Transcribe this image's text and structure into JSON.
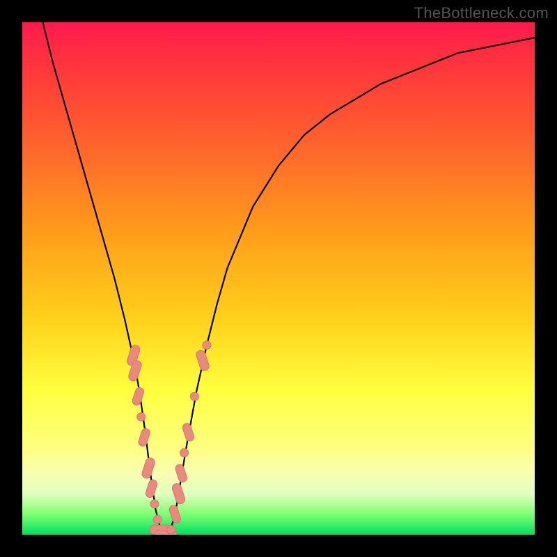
{
  "watermark": "TheBottleneck.com",
  "colors": {
    "frame": "#000000",
    "gradient_stops": [
      "#ff1a4d",
      "#ff3a3a",
      "#ff6a2a",
      "#ff9a1a",
      "#ffd21a",
      "#ffff40",
      "#ffff80",
      "#f8ffb0",
      "#e0ffc0",
      "#7fff70",
      "#00e060"
    ],
    "curve": "#000000",
    "marker_fill": "#e88a7e",
    "marker_stroke": "#d8766b"
  },
  "chart_data": {
    "type": "line",
    "title": "",
    "xlabel": "",
    "ylabel": "",
    "xlim": [
      0,
      100
    ],
    "ylim": [
      0,
      100
    ],
    "grid": false,
    "legend": false,
    "annotations": [],
    "series": [
      {
        "name": "bottleneck-curve",
        "x": [
          4,
          6,
          8,
          10,
          12,
          14,
          16,
          18,
          20,
          22,
          23,
          24,
          25,
          26,
          27,
          28,
          29,
          30,
          32,
          34,
          36,
          38,
          40,
          45,
          50,
          55,
          60,
          65,
          70,
          75,
          80,
          85,
          90,
          95,
          100
        ],
        "y": [
          100,
          92,
          85,
          78,
          71,
          64,
          57,
          50,
          42,
          33,
          27,
          20,
          12,
          5,
          1,
          0,
          1,
          5,
          17,
          28,
          37,
          45,
          52,
          64,
          72,
          78,
          82,
          85,
          88,
          90,
          92,
          94,
          95,
          96,
          97
        ]
      }
    ],
    "markers": [
      {
        "x": 21.7,
        "y": 35,
        "shape": "pill-v",
        "size": 3
      },
      {
        "x": 22.0,
        "y": 32,
        "shape": "pill-v",
        "size": 3
      },
      {
        "x": 22.6,
        "y": 27,
        "shape": "pill-v",
        "size": 2
      },
      {
        "x": 23.2,
        "y": 23,
        "shape": "circle",
        "size": 2
      },
      {
        "x": 23.8,
        "y": 19,
        "shape": "pill-v",
        "size": 2
      },
      {
        "x": 24.6,
        "y": 13,
        "shape": "pill-v",
        "size": 3
      },
      {
        "x": 25.2,
        "y": 9,
        "shape": "pill-v",
        "size": 2
      },
      {
        "x": 25.8,
        "y": 6,
        "shape": "circle",
        "size": 2
      },
      {
        "x": 26.4,
        "y": 3,
        "shape": "circle",
        "size": 2
      },
      {
        "x": 27.0,
        "y": 1,
        "shape": "pill-h",
        "size": 3
      },
      {
        "x": 28.0,
        "y": 0,
        "shape": "pill-h",
        "size": 3
      },
      {
        "x": 29.0,
        "y": 1,
        "shape": "circle",
        "size": 2
      },
      {
        "x": 29.8,
        "y": 4,
        "shape": "pill-v",
        "size": 2
      },
      {
        "x": 30.5,
        "y": 8,
        "shape": "pill-v",
        "size": 3
      },
      {
        "x": 31.0,
        "y": 12,
        "shape": "pill-v",
        "size": 2
      },
      {
        "x": 31.6,
        "y": 16,
        "shape": "circle",
        "size": 2
      },
      {
        "x": 32.4,
        "y": 20,
        "shape": "pill-v",
        "size": 2
      },
      {
        "x": 33.6,
        "y": 27,
        "shape": "circle",
        "size": 2
      },
      {
        "x": 35.2,
        "y": 34,
        "shape": "pill-v",
        "size": 3
      },
      {
        "x": 36.0,
        "y": 37,
        "shape": "circle",
        "size": 2
      }
    ]
  }
}
